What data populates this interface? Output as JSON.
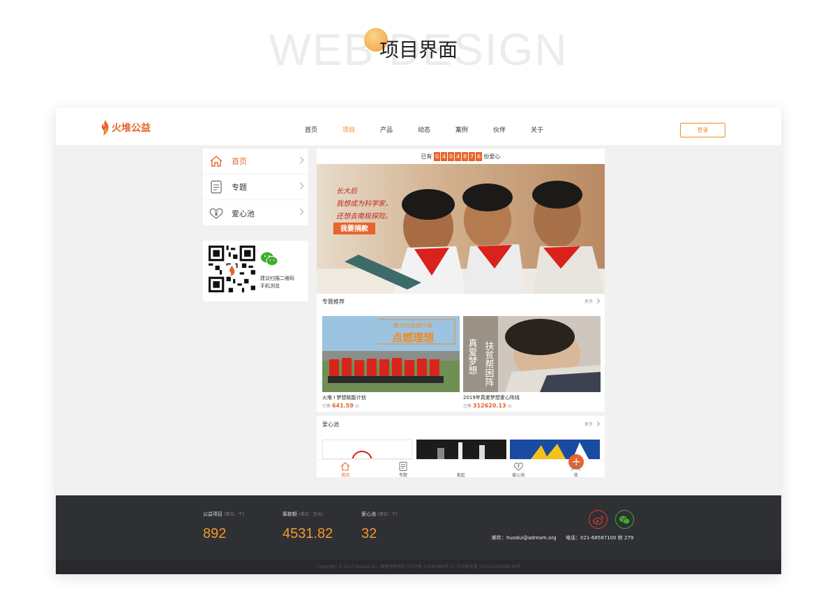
{
  "heading": {
    "background_text": "WEB DESIGN",
    "title": "项目界面"
  },
  "site": {
    "logo_text": "火堆公益",
    "nav": [
      {
        "label": "首页",
        "active": false
      },
      {
        "label": "项目",
        "active": true
      },
      {
        "label": "产品",
        "active": false
      },
      {
        "label": "动态",
        "active": false
      },
      {
        "label": "案例",
        "active": false
      },
      {
        "label": "伙伴",
        "active": false
      },
      {
        "label": "关于",
        "active": false
      }
    ],
    "login_label": "登录"
  },
  "side_menu": {
    "items": [
      {
        "label": "首页",
        "icon": "home-icon",
        "active": true
      },
      {
        "label": "专题",
        "icon": "document-icon",
        "active": false
      },
      {
        "label": "爱心池",
        "icon": "heart-yuan-icon",
        "active": false
      }
    ]
  },
  "qr_box": {
    "line1": "建议扫描二维码",
    "line2": "手机浏览"
  },
  "counter": {
    "prefix": "已有",
    "digits": [
      "0",
      "4",
      "0",
      "4",
      "8",
      "7",
      "6"
    ],
    "suffix": "份爱心"
  },
  "hero": {
    "text_lines": [
      "长大后",
      "我想成为科学家，",
      "还想去南极探险。"
    ],
    "button_label": "我要捐款"
  },
  "topics": {
    "title": "专题推荐",
    "more": "更多",
    "cards": [
      {
        "title": "火堆 I 梦想赋能计划",
        "raised_label": "已筹",
        "amount": "641.59",
        "unit": "元",
        "img_line1": "助力公益践行者",
        "img_line2": "点燃理想"
      },
      {
        "title": "2019年真爱梦想爱心阵线",
        "raised_label": "已筹",
        "amount": "312620.13",
        "unit": "元",
        "img_line1": "真爱梦想",
        "img_line2": "扶贫帮困阵"
      }
    ]
  },
  "pool": {
    "title": "爱心池",
    "more": "更多"
  },
  "tabbar": [
    {
      "label": "首页",
      "icon": "home-icon",
      "active": true
    },
    {
      "label": "专题",
      "icon": "document-icon",
      "active": false
    },
    {
      "label": "发起",
      "icon": "plus-icon",
      "active": false
    },
    {
      "label": "爱心池",
      "icon": "heart-yuan-icon",
      "active": false
    },
    {
      "label": "我",
      "icon": "user-icon",
      "active": false
    }
  ],
  "footer": {
    "stats": [
      {
        "label": "公益项目",
        "unit": "(单位：个)",
        "value": "892"
      },
      {
        "label": "筹款额",
        "unit": "(单位：万元)",
        "value": "4531.82"
      },
      {
        "label": "爱心池",
        "unit": "(单位：个)",
        "value": "32"
      }
    ],
    "email": "邮件：huodui@adream.org",
    "phone": "电话：021-68587100 转 279",
    "copyright": "Copyright © 2017 huodui Inc. 保留所有权利 沪ICP备 13042489号-5 · 沪公网安备 31011502408234号"
  },
  "colors": {
    "accent": "#e8642b",
    "orange": "#f08a23",
    "footer_bg": "#2f3034",
    "stat_value": "#f39a2b",
    "weibo": "#e33a2f",
    "wechat": "#3dab2e"
  }
}
